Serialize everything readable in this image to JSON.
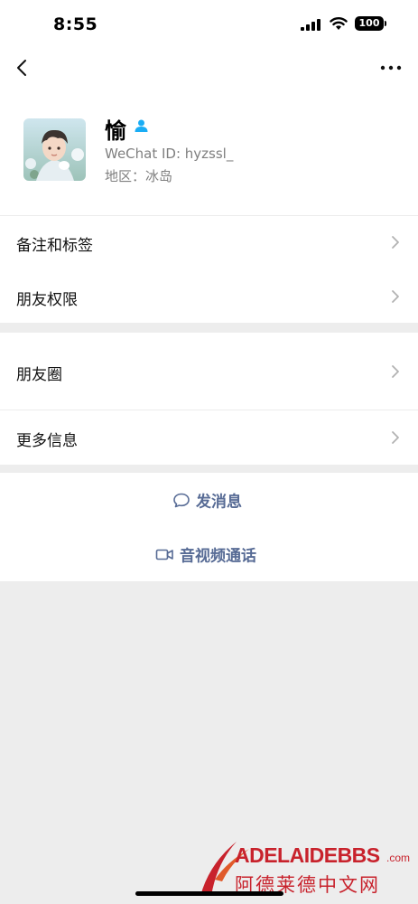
{
  "status_bar": {
    "time": "8:55",
    "battery": "100"
  },
  "nav": {
    "back_icon": "chevron-left-icon",
    "more_icon": "ellipsis-icon"
  },
  "profile": {
    "name": "愉",
    "wechat_id": "WeChat ID: hyzssl_",
    "region": "地区：冰岛",
    "gender_icon": "person-icon",
    "accent": "#1aadf5"
  },
  "menu": {
    "remarks_tags": "备注和标签",
    "friend_permissions": "朋友权限",
    "moments": "朋友圈",
    "more_info": "更多信息"
  },
  "actions": {
    "send_message": "发消息",
    "video_call": "音视频通话",
    "link_color": "#576b95"
  },
  "watermark": {
    "brand_prefix": "ADELAIDE",
    "brand_suffix": "BBS",
    "domain": ".com",
    "cn_text": "阿德莱德中文网"
  }
}
